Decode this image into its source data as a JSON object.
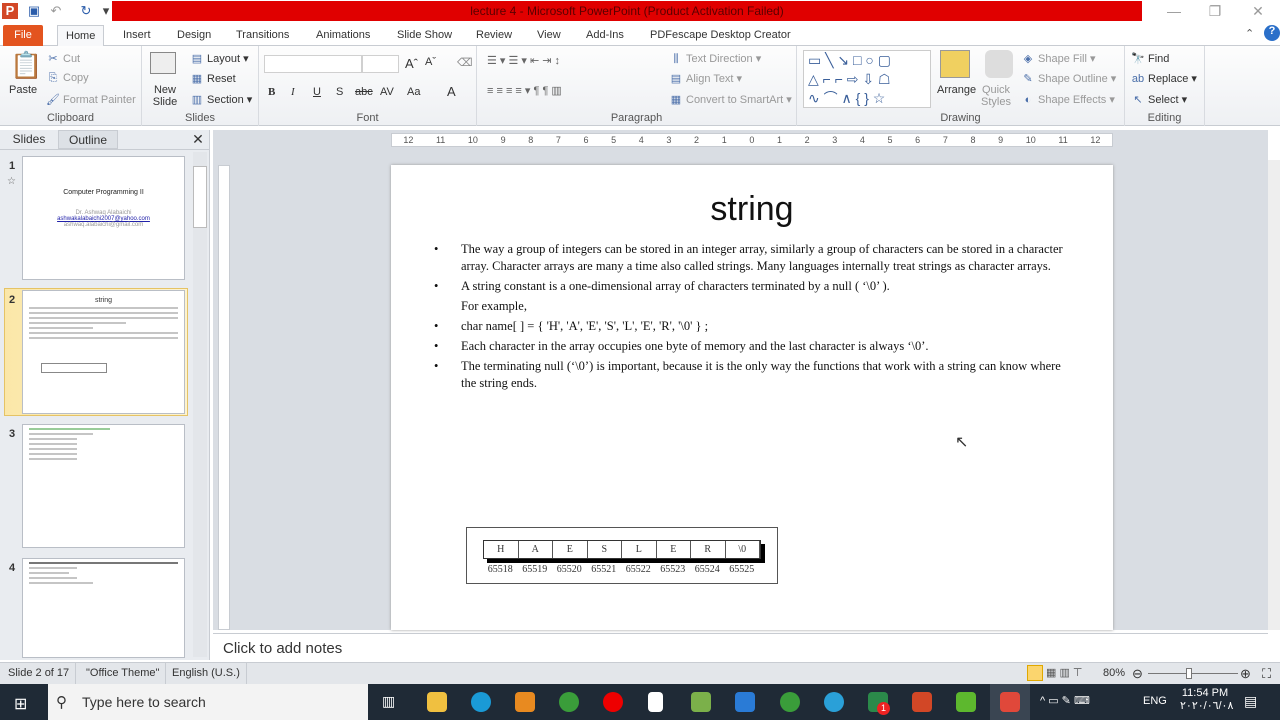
{
  "window": {
    "title": "lecture 4  -  Microsoft PowerPoint (Product Activation Failed)",
    "minimize": "—",
    "restore": "❐",
    "close": "✕"
  },
  "tabs": [
    "File",
    "Home",
    "Insert",
    "Design",
    "Transitions",
    "Animations",
    "Slide Show",
    "Review",
    "View",
    "Add-Ins",
    "PDFescape Desktop Creator"
  ],
  "ribbon": {
    "clipboard": {
      "label": "Clipboard",
      "paste": "Paste",
      "cut": "Cut",
      "copy": "Copy",
      "format_painter": "Format Painter"
    },
    "slides": {
      "label": "Slides",
      "new_slide": "New Slide",
      "layout": "Layout",
      "reset": "Reset",
      "section": "Section"
    },
    "font": {
      "label": "Font",
      "bold": "B",
      "italic": "I",
      "underline": "U",
      "shadow": "S",
      "strike": "abc",
      "spacing": "AV",
      "case": "Aa",
      "color": "A",
      "grow": "Aˆ",
      "shrink": "Aˇ"
    },
    "paragraph": {
      "label": "Paragraph",
      "text_direction": "Text Direction",
      "align_text": "Align Text",
      "smartart": "Convert to SmartArt"
    },
    "drawing": {
      "label": "Drawing",
      "arrange": "Arrange",
      "quick_styles": "Quick Styles",
      "shape_fill": "Shape Fill",
      "shape_outline": "Shape Outline",
      "shape_effects": "Shape Effects"
    },
    "editing": {
      "label": "Editing",
      "find": "Find",
      "replace": "Replace",
      "select": "Select"
    }
  },
  "panel": {
    "tabs": [
      "Slides",
      "Outline"
    ],
    "close": "✕",
    "thumbs": [
      {
        "num": "1",
        "title": "Computer  Programming  II",
        "author": "Dr. Ashwaq Alabaichi",
        "email1": "ashwakalabaichi2007@yahoo.com",
        "email2": "ashwaq.alabaichi@gmail.com"
      },
      {
        "num": "2",
        "title": "string"
      },
      {
        "num": "3"
      },
      {
        "num": "4"
      }
    ]
  },
  "ruler": [
    "12",
    "11",
    "10",
    "9",
    "8",
    "7",
    "6",
    "5",
    "4",
    "3",
    "2",
    "1",
    "0",
    "1",
    "2",
    "3",
    "4",
    "5",
    "6",
    "7",
    "8",
    "9",
    "10",
    "11",
    "12"
  ],
  "slide": {
    "title": "string",
    "bullets": [
      {
        "bullet": "•",
        "text": " The way a group of integers can be stored in an integer array, similarly  a group of characters can be stored in a character array. Character arrays are many a time also called strings. Many languages internally  treat strings  as character arrays."
      },
      {
        "bullet": "•",
        "text": "A string constant is a one-dimensional  array of characters terminated by a null  ( ‘\\0’ )."
      },
      {
        "bullet": "",
        "text": "  For  example,"
      },
      {
        "bullet": "•",
        "text": "     char  name[ ] = { 'H', 'A', 'E', 'S', 'L', 'E', 'R', '\\0' } ;"
      },
      {
        "bullet": "•",
        "text": " Each character in the array occupies one byte of memory and the last character is always ‘\\0’."
      },
      {
        "bullet": "•",
        "text": "The terminating  null  (‘\\0’) is important,  because it is the only  way the functions that work with a string can know where the string ends."
      }
    ],
    "array": {
      "chars": [
        "H",
        "A",
        "E",
        "S",
        "L",
        "E",
        "R",
        "\\0"
      ],
      "addresses": [
        "65518",
        "65519",
        "65520",
        "65521",
        "65522",
        "65523",
        "65524",
        "65525"
      ]
    }
  },
  "notes": {
    "placeholder": "Click to add notes"
  },
  "status": {
    "slide": "Slide 2 of 17",
    "theme": "\"Office Theme\"",
    "language": "English (U.S.)",
    "zoom": "80%",
    "zoom_fraction": 0.45
  },
  "taskbar": {
    "search_placeholder": "Type here to search",
    "time": "11:54 PM",
    "date": "٢٠٢٠/٠٦/٠٨",
    "lang": "ENG",
    "badge": "1"
  }
}
